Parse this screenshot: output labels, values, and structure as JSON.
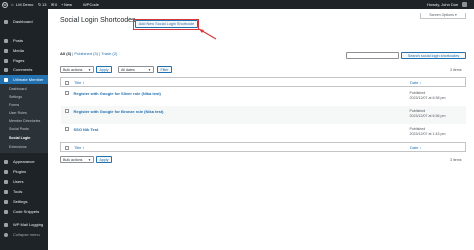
{
  "admin_bar": {
    "site_name": "LM Demo",
    "updates_count": "13",
    "comments_count": "0",
    "new_label": "New",
    "wpcode_label": "WPCode",
    "greeting": "Howdy, John Doe"
  },
  "sidebar": {
    "items": [
      {
        "label": "Dashboard"
      },
      {
        "label": "Posts"
      },
      {
        "label": "Media"
      },
      {
        "label": "Pages"
      },
      {
        "label": "Comments"
      },
      {
        "label": "Ultimate Member"
      }
    ],
    "um_submenu": [
      {
        "label": "Dashboard"
      },
      {
        "label": "Settings"
      },
      {
        "label": "Forms"
      },
      {
        "label": "User Roles"
      },
      {
        "label": "Member Directories"
      },
      {
        "label": "Social Posts"
      },
      {
        "label": "Social Login"
      },
      {
        "label": "Extensions"
      }
    ],
    "items_bottom": [
      {
        "label": "Appearance"
      },
      {
        "label": "Plugins"
      },
      {
        "label": "Users"
      },
      {
        "label": "Tools"
      },
      {
        "label": "Settings"
      },
      {
        "label": "Code Snippets"
      },
      {
        "label": "WP Mail Logging"
      },
      {
        "label": "Collapse menu"
      }
    ]
  },
  "header": {
    "title": "Social Login Shortcodes",
    "add_new_label": "Add New Social Login Shortcode",
    "screen_options_label": "Screen Options ▾"
  },
  "filters": {
    "all_label": "All (3)",
    "published_label": "Published (3)",
    "trash_label": "Trash (2)",
    "sep": "|",
    "search_button_label": "Search social login shortcodes",
    "bulk_actions_label": "Bulk actions",
    "apply_label": "Apply",
    "dates_label": "All dates",
    "filter_label": "Filter",
    "items_count": "3 items"
  },
  "table": {
    "col_title": "Title ↕",
    "col_date": "Date ↓",
    "rows": [
      {
        "title": "Register with Google for Silver role (Nika test)",
        "status": "Published",
        "date": "2023/12/07 at 6:38 pm"
      },
      {
        "title": "Register with Google for Bronze role (Nika test)",
        "status": "Published",
        "date": "2023/12/07 at 6:36 pm"
      },
      {
        "title": "SSO Nik Test",
        "status": "Published",
        "date": "2023/12/07 at 1:43 pm"
      }
    ]
  },
  "colors": {
    "admin_dark": "#1d2327",
    "accent_blue": "#2271b1",
    "highlight_red": "#d63638"
  }
}
